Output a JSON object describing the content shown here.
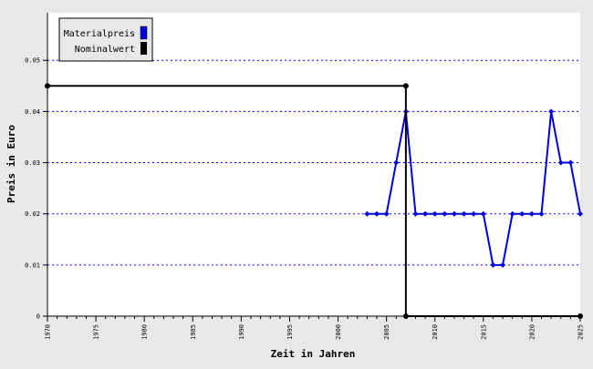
{
  "chart_data": {
    "type": "line",
    "xlabel": "Zeit in Jahren",
    "ylabel": "Preis in Euro",
    "xlim": [
      1970,
      2025
    ],
    "ylim": [
      0,
      0.05
    ],
    "x_ticks": [
      "1970",
      "1975",
      "1980",
      "1985",
      "1990",
      "1995",
      "2000",
      "2005",
      "2010",
      "2015",
      "2020",
      "2025"
    ],
    "y_ticks": [
      "0",
      "0.01",
      "0.02",
      "0.03",
      "0.04",
      "0.05"
    ],
    "grid": "horizontal-dotted",
    "legend_position": "top-left",
    "series": [
      {
        "name": "Materialpreis",
        "color": "#0000dd",
        "marker": "diamond",
        "points": [
          [
            2003,
            0.02
          ],
          [
            2004,
            0.02
          ],
          [
            2005,
            0.02
          ],
          [
            2006,
            0.03
          ],
          [
            2007,
            0.04
          ],
          [
            2008,
            0.02
          ],
          [
            2009,
            0.02
          ],
          [
            2010,
            0.02
          ],
          [
            2011,
            0.02
          ],
          [
            2012,
            0.02
          ],
          [
            2013,
            0.02
          ],
          [
            2014,
            0.02
          ],
          [
            2015,
            0.02
          ],
          [
            2016,
            0.01
          ],
          [
            2017,
            0.01
          ],
          [
            2018,
            0.02
          ],
          [
            2019,
            0.02
          ],
          [
            2020,
            0.02
          ],
          [
            2021,
            0.02
          ],
          [
            2022,
            0.04
          ],
          [
            2023,
            0.03
          ],
          [
            2024,
            0.03
          ],
          [
            2025,
            0.02
          ]
        ]
      },
      {
        "name": "Nominalwert",
        "color": "#000000",
        "marker": "circle",
        "points": [
          [
            1970,
            0.045
          ],
          [
            2007,
            0.045
          ],
          [
            2007,
            0
          ],
          [
            2025,
            0
          ]
        ]
      }
    ]
  }
}
